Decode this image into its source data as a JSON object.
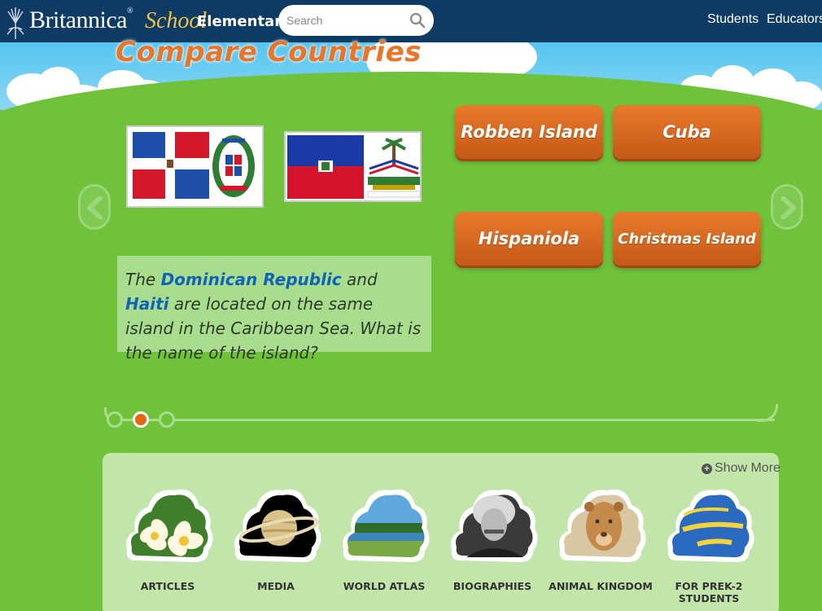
{
  "header": {
    "brand": "Britannica",
    "brand_school": "School",
    "level": "Elementary",
    "search_placeholder": "Search",
    "nav": [
      "Students",
      "Educators"
    ]
  },
  "quiz": {
    "title": "Compare Countries",
    "answers": [
      "Robben Island",
      "Cuba",
      "Hispaniola",
      "Christmas Island"
    ],
    "question": {
      "pre": "The ",
      "country1": "Dominican Republic",
      "mid": " and ",
      "country2": "Haiti",
      "post": " are located on the same island in the Caribbean Sea. What is the name of the island?"
    },
    "slide_count": 3,
    "active_slide": 2
  },
  "categories": {
    "show_more": "Show More",
    "items": [
      {
        "label": "ARTICLES",
        "icon": "flower-icon"
      },
      {
        "label": "MEDIA",
        "icon": "saturn-icon"
      },
      {
        "label": "WORLD ATLAS",
        "icon": "landscape-icon"
      },
      {
        "label": "BIOGRAPHIES",
        "icon": "portrait-icon"
      },
      {
        "label": "ANIMAL KINGDOM",
        "icon": "lion-icon"
      },
      {
        "label": "FOR PREK-2 STUDENTS",
        "icon": "learning-zone-icon"
      }
    ]
  },
  "colors": {
    "header_bg": "#0d3b63",
    "grass": "#6fc23a",
    "answer_orange": "#d9661f",
    "link_blue": "#1263b8",
    "panel": "#c2e5aa"
  }
}
